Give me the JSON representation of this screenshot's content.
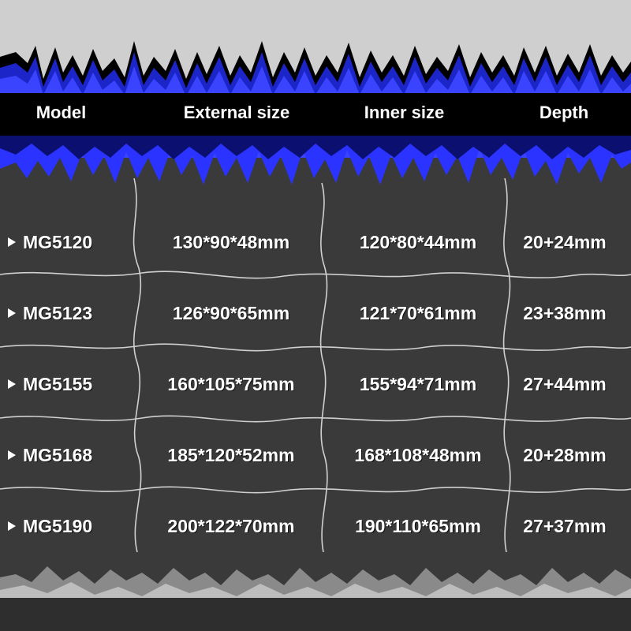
{
  "colors": {
    "background": "#3a3a3a",
    "header_band": "#000000",
    "accent": "#2233ff",
    "grid_line": "#cfcfcf",
    "text": "#ffffff"
  },
  "table": {
    "headers": {
      "model": "Model",
      "external": "External size",
      "inner": "Inner size",
      "depth": "Depth"
    },
    "row_marker_icon": "triangle-right-icon",
    "rows": [
      {
        "model": "MG5120",
        "external": "130*90*48mm",
        "inner": "120*80*44mm",
        "depth": "20+24mm"
      },
      {
        "model": "MG5123",
        "external": "126*90*65mm",
        "inner": "121*70*61mm",
        "depth": "23+38mm"
      },
      {
        "model": "MG5155",
        "external": "160*105*75mm",
        "inner": "155*94*71mm",
        "depth": "27+44mm"
      },
      {
        "model": "MG5168",
        "external": "185*120*52mm",
        "inner": "168*108*48mm",
        "depth": "20+28mm"
      },
      {
        "model": "MG5190",
        "external": "200*122*70mm",
        "inner": "190*110*65mm",
        "depth": "27+37mm"
      }
    ]
  }
}
